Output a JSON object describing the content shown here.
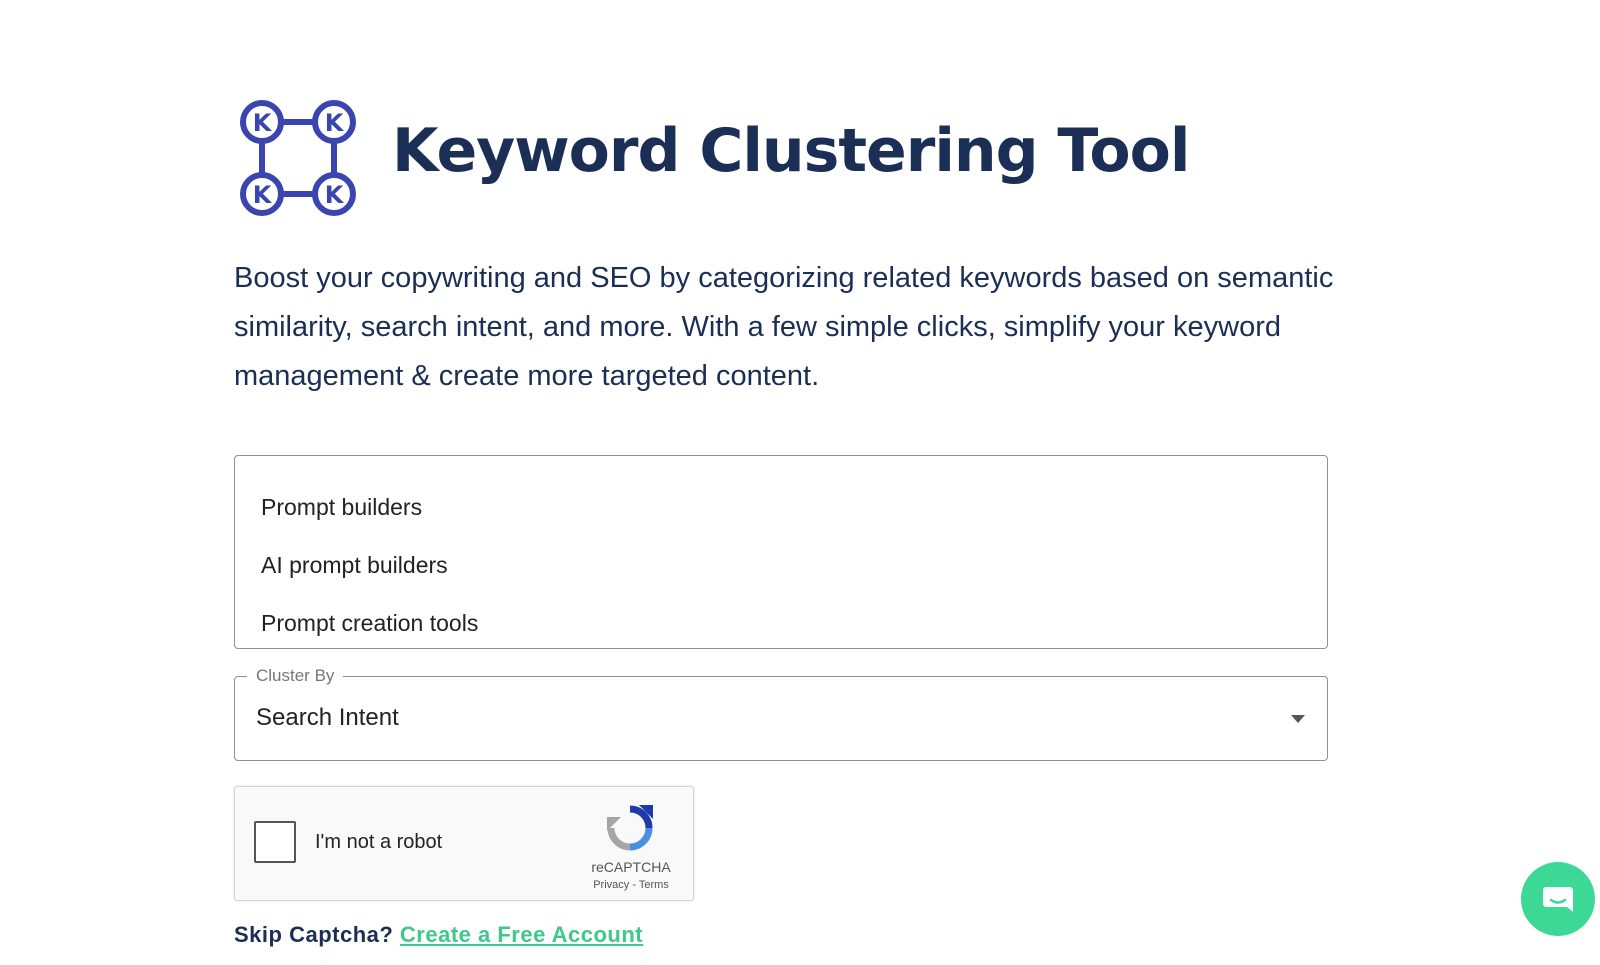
{
  "header": {
    "logo_letters": [
      "K",
      "K",
      "K",
      "K"
    ],
    "title": "Keyword Clustering Tool"
  },
  "description": "Boost your copywriting and SEO by categorizing related keywords based on semantic similarity, search intent, and more. With a few simple clicks, simplify your keyword management & create more targeted content.",
  "keywords_input": {
    "lines": [
      "Prompt builders",
      "AI prompt builders",
      "Prompt creation tools"
    ]
  },
  "cluster_by": {
    "label": "Cluster By",
    "selected": "Search Intent"
  },
  "captcha": {
    "label": "I'm not a robot",
    "brand": "reCAPTCHA",
    "links": "Privacy - Terms"
  },
  "skip": {
    "prefix": "Skip Captcha? ",
    "link_label": "Create a Free Account"
  },
  "colors": {
    "brand_navy": "#1b2e55",
    "logo_blue": "#3a45b0",
    "link_green": "#3ec98b",
    "chat_green": "#3dd895"
  },
  "icons": {
    "logo": "keyword-cluster-logo-icon",
    "recaptcha": "recaptcha-icon",
    "chat": "chat-icon",
    "caret": "chevron-down-icon"
  }
}
